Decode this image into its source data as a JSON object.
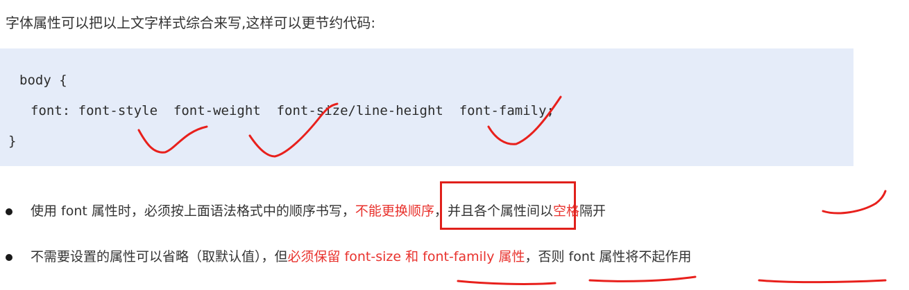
{
  "intro": "字体属性可以把以上文字样式综合来写,这样可以更节约代码:",
  "code": {
    "line1": "body {",
    "line2": "font: font-style  font-weight  font-size/line-height  font-family;",
    "line3": "}"
  },
  "bullets": [
    {
      "before": "使用 font 属性时，必须按上面语法格式中的顺序书写",
      "comma1": "，",
      "highlight": "不能更换顺序",
      "comma2": "，",
      "middle": "并且各个属性间以",
      "red_word": "空格",
      "after": "隔开"
    },
    {
      "before": "不需要设置的属性可以省略（取默认值），但",
      "red": "必须保留 font-size 和 font-family 属性",
      "after": "，否则 font 属性将不起作用"
    }
  ],
  "colors": {
    "code_background": "#e5ecf9",
    "emphasis_red": "#e8322d",
    "annotation_red": "#e8201c"
  }
}
